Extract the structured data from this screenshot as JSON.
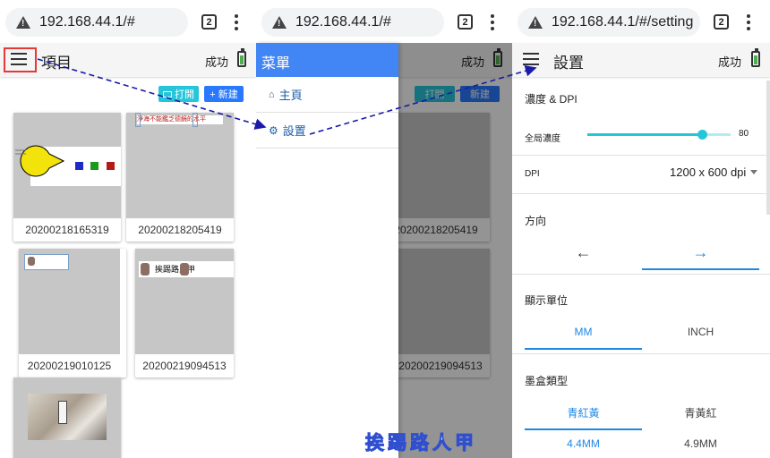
{
  "browser": {
    "url_home": "192.168.44.1/#",
    "url_setting": "192.168.44.1/#/setting",
    "tab_count": "2"
  },
  "panel1": {
    "title": "項目",
    "status": "成功",
    "open_label": "打開",
    "new_label": "+ 新建",
    "cards": [
      {
        "label": "20200218165319",
        "thumb": "pacman-and-squares"
      },
      {
        "label": "20200218205419",
        "thumb": "red-text-banner"
      },
      {
        "label": "20200219010125",
        "thumb": "small-face-label"
      },
      {
        "label": "20200219094513",
        "thumb": "faces-label-strip"
      },
      {
        "label": "",
        "thumb": "hand-holding-printer-photo"
      }
    ],
    "thumb_texts": {
      "banner": "淨海不能鑑乏德鏡的水平",
      "strip": "挨踢路人甲"
    }
  },
  "panel2": {
    "drawer_title": "菜單",
    "items": [
      {
        "label": "主頁",
        "icon": "home-icon"
      },
      {
        "label": "設置",
        "icon": "gear-icon"
      }
    ],
    "status": "成功",
    "open_label": "打開",
    "new_label": "新建",
    "card_labels": [
      "20200218205419",
      "20200219094513"
    ]
  },
  "panel3": {
    "title": "設置",
    "status": "成功",
    "density_section": "濃度 & DPI",
    "density_label": "全局濃度",
    "density_value": "80",
    "density_fraction": 0.8,
    "dpi_label": "DPI",
    "dpi_value": "1200 x 600 dpi",
    "direction_label": "方向",
    "direction_tabs": [
      "←",
      "→"
    ],
    "unit_label": "顯示單位",
    "unit_tabs": [
      "MM",
      "INCH"
    ],
    "cartridge_label": "墨盒類型",
    "cartridge_tabs": [
      "青紅黃",
      "青黃紅"
    ],
    "size_tabs": [
      "4.4MM",
      "4.9MM"
    ]
  },
  "watermark": "挨踢路人甲",
  "colors": {
    "highlight_box": "#e53935",
    "arrow": "#1a1aaa",
    "drawer_header": "#4285f4",
    "slider": "#26c6da",
    "accent_tab": "#1e88e5",
    "open_button": "#26c6da",
    "new_button": "#2979ff"
  }
}
